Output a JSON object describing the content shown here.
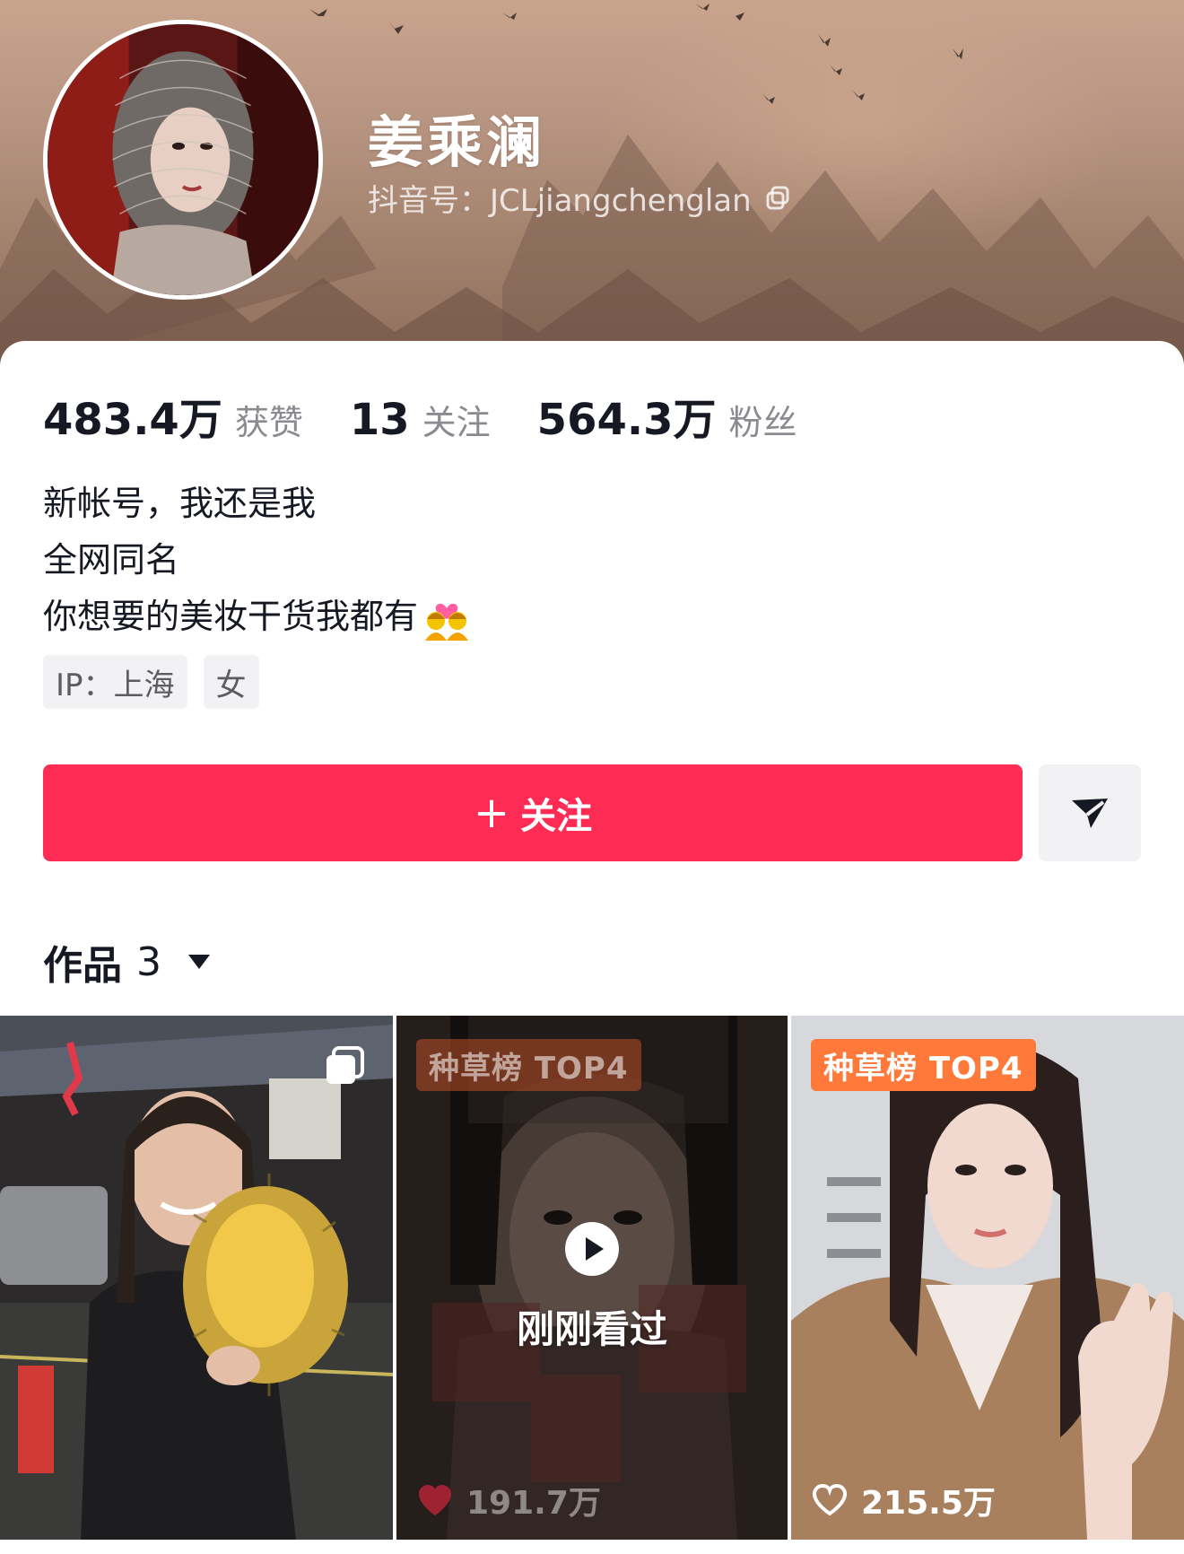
{
  "profile": {
    "name": "姜乘澜",
    "douyin_id": "抖音号：JCLjiangchenglan"
  },
  "stats": [
    {
      "value": "483.4万",
      "label": "获赞"
    },
    {
      "value": "13",
      "label": "关注"
    },
    {
      "value": "564.3万",
      "label": "粉丝"
    }
  ],
  "bio": {
    "line1": "新帐号，我还是我",
    "line2": "全网同名",
    "line3": "你想要的美妆干货我都有"
  },
  "tags": {
    "ip": "IP：上海",
    "gender": "女"
  },
  "actions": {
    "follow_plus": "+",
    "follow_label": "关注"
  },
  "works": {
    "label": "作品",
    "count": "3"
  },
  "videos": [
    {
      "badge": "",
      "likes": "",
      "multi_image": true
    },
    {
      "badge": "种草榜 TOP4",
      "overlay": "刚刚看过",
      "likes": "191.7万"
    },
    {
      "badge": "种草榜 TOP4",
      "likes": "215.5万"
    }
  ],
  "colors": {
    "follow_button": "#fe2c55",
    "badge_orange": "#ff7a3a",
    "text_primary": "#161823",
    "text_secondary": "#8a8b91"
  },
  "icons": [
    "copy-icon",
    "send-icon",
    "caret-down-icon",
    "multi-image-icon",
    "play-icon",
    "heart-icon"
  ]
}
